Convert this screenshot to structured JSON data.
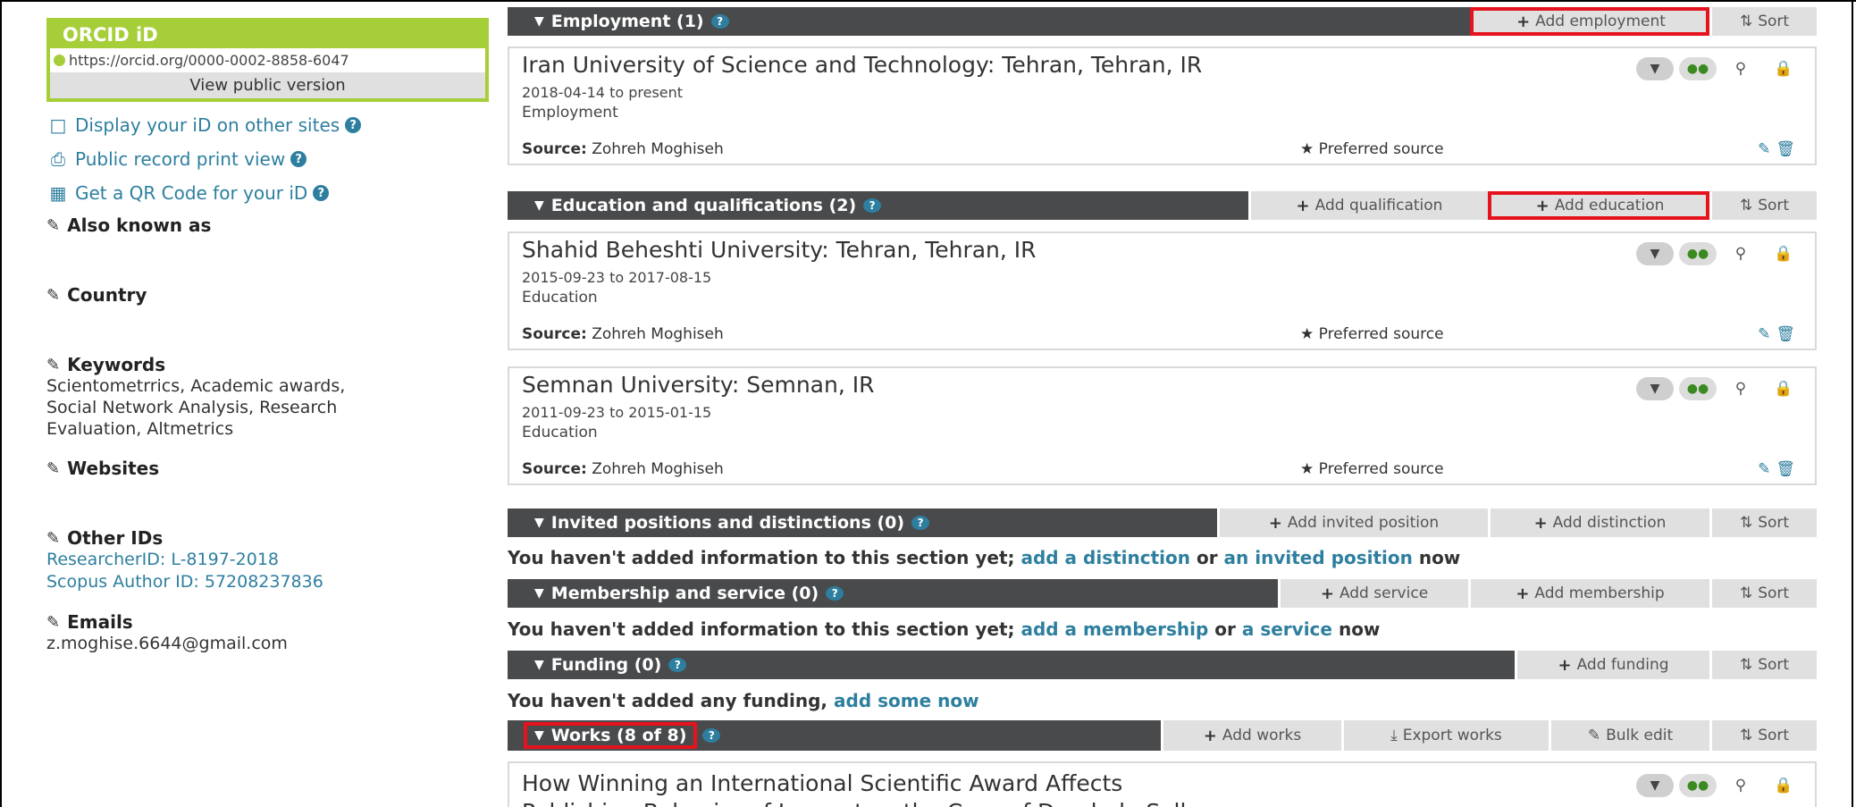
{
  "sidebar": {
    "orcid_title": "ORCID iD",
    "orcid_url": "https://orcid.org/0000-0002-8858-6047",
    "view_public": "View public version",
    "links": [
      {
        "label": "Display your iD on other sites",
        "icon": "monitor-icon"
      },
      {
        "label": "Public record print view",
        "icon": "printer-icon"
      },
      {
        "label": "Get a QR Code for your iD",
        "icon": "qr-code-icon"
      }
    ],
    "also_known_as": "Also known as",
    "country": "Country",
    "keywords_label": "Keywords",
    "keywords": [
      "Scientometrrics, Academic awards,",
      "Social Network Analysis, Research",
      "Evaluation, Altmetrics"
    ],
    "websites": "Websites",
    "other_ids_label": "Other IDs",
    "other_ids": [
      "ResearcherID: L-8197-2018",
      "Scopus Author ID: 57208237836"
    ],
    "emails_label": "Emails",
    "email": "z.moghise.6644@gmail.com"
  },
  "main": {
    "employment": {
      "title": "Employment (1)",
      "add": "Add employment",
      "sort": "Sort",
      "items": [
        {
          "title": "Iran University of Science and Technology: Tehran, Tehran, IR",
          "date": "2018-04-14 to present",
          "type": "Employment",
          "source_label": "Source:",
          "source": "Zohreh Moghiseh",
          "preferred": "Preferred source"
        }
      ]
    },
    "education": {
      "title": "Education and qualifications (2)",
      "add_qualification": "Add qualification",
      "add_education": "Add education",
      "sort": "Sort",
      "items": [
        {
          "title": "Shahid Beheshti University: Tehran, Tehran, IR",
          "date": "2015-09-23 to 2017-08-15",
          "type": "Education",
          "source_label": "Source:",
          "source": "Zohreh Moghiseh",
          "preferred": "Preferred source"
        },
        {
          "title": "Semnan University: Semnan, IR",
          "date": "2011-09-23 to 2015-01-15",
          "type": "Education",
          "source_label": "Source:",
          "source": "Zohreh Moghiseh",
          "preferred": "Preferred source"
        }
      ]
    },
    "invited": {
      "title": "Invited positions and distinctions (0)",
      "add_invited": "Add invited position",
      "add_distinction": "Add distinction",
      "sort": "Sort",
      "msg_pre": "You haven't added information to this section yet;",
      "link1": "add a distinction",
      "or": "or",
      "link2": "an invited position",
      "msg_post": "now"
    },
    "membership": {
      "title": "Membership and service (0)",
      "add_service": "Add service",
      "add_membership": "Add membership",
      "sort": "Sort",
      "msg_pre": "You haven't added information to this section yet;",
      "link1": "add a membership",
      "or": "or",
      "link2": "a service",
      "msg_post": "now"
    },
    "funding": {
      "title": "Funding (0)",
      "add": "Add funding",
      "sort": "Sort",
      "msg_pre": "You haven't added any funding,",
      "link": "add some now"
    },
    "works": {
      "title": "Works (8 of 8)",
      "add": "Add works",
      "export": "Export works",
      "bulk": "Bulk edit",
      "sort": "Sort",
      "first_item_line1": "How Winning an International Scientific Award Affects",
      "first_item_line2": "Publishing Behavior of Laureates: the Case of Derek de Solla"
    }
  },
  "colors": {
    "highlight": "#e5131d",
    "orcid_green": "#a6ce39",
    "link_blue": "#2e7f9f",
    "bar_dark": "#494a4c"
  }
}
